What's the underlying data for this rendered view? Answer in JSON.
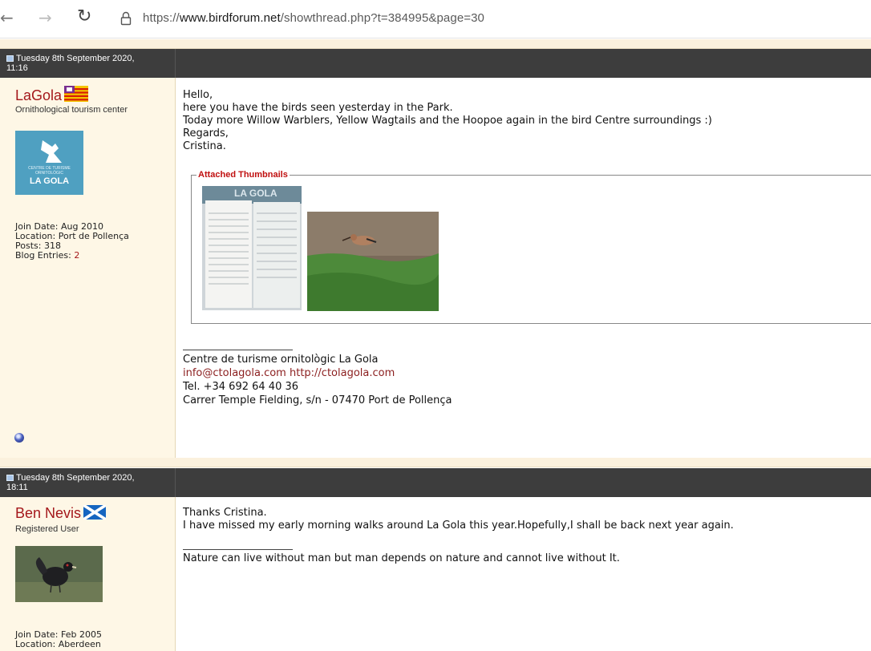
{
  "browser": {
    "back_icon": "back-arrow-icon",
    "forward_icon": "forward-arrow-icon",
    "reload_icon": "reload-icon",
    "lock_icon": "lock-icon",
    "url_prefix": "https://",
    "url_host": "www.birdforum.net",
    "url_path": "/showthread.php?t=384995&page=30"
  },
  "colors": {
    "username": "#a4181b",
    "post_header_bg": "#3d3d3d",
    "user_column_bg": "#fef7e6",
    "legend_red": "#c01010"
  },
  "posts": [
    {
      "date_line1": "Tuesday 8th September 2020,",
      "date_line2": "11:16",
      "username": "LaGola",
      "flag_icon": "balearic-islands-flag-icon",
      "user_title": "Ornithological tourism center",
      "avatar_text_small": "CENTRE DE TURISME\nORNITOLÒGIC",
      "avatar_text_large": "LA GOLA",
      "join_date": "Join Date: Aug 2010",
      "location": "Location: Port de Pollença",
      "posts": "Posts: 318",
      "blog_label": "Blog Entries: ",
      "blog_count": "2",
      "message": [
        "Hello,",
        "here you have the birds seen yesterday in the Park.",
        "Today more Willow Warblers, Yellow Wagtails and the Hoopoe again in the bird Centre surroundings :)",
        "Regards,",
        "Cristina."
      ],
      "attachments_legend": "Attached Thumbnails",
      "thumb1_text": "LA GOLA",
      "signature_name": "Centre de turisme ornitològic La Gola",
      "signature_email": "info@ctolagola.com",
      "signature_url": "http://ctolagola.com",
      "signature_tel": "Tel. +34 692 64 40 36",
      "signature_address": "Carrer Temple Fielding, s/n - 07470 Port de Pollença"
    },
    {
      "date_line1": "Tuesday 8th September 2020,",
      "date_line2": "18:11",
      "username": "Ben Nevis",
      "flag_icon": "scotland-flag-icon",
      "user_title": "Registered User",
      "join_date": "Join Date: Feb 2005",
      "location": "Location: Aberdeen",
      "message": [
        "Thanks Cristina.",
        "I have missed my early morning walks around La Gola this year.Hopefully,I shall be back next year again."
      ],
      "signature": "Nature can live without man but man depends on nature and cannot live without It."
    }
  ]
}
